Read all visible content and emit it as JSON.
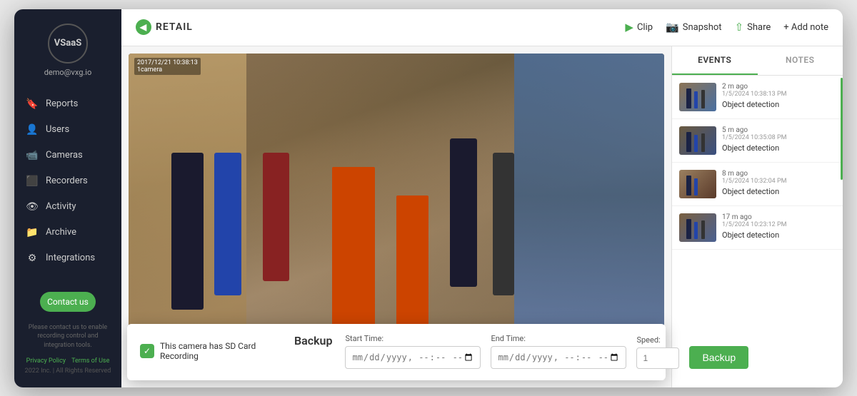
{
  "sidebar": {
    "logo_text": "VSaaS",
    "user_email": "demo@vxg.io",
    "nav_items": [
      {
        "id": "reports",
        "label": "Reports",
        "icon": "🔖"
      },
      {
        "id": "users",
        "label": "Users",
        "icon": "👤"
      },
      {
        "id": "cameras",
        "label": "Cameras",
        "icon": "📹"
      },
      {
        "id": "recorders",
        "label": "Recorders",
        "icon": "⬛"
      },
      {
        "id": "activity",
        "label": "Activity",
        "icon": "👁"
      },
      {
        "id": "archive",
        "label": "Archive",
        "icon": "📁"
      },
      {
        "id": "integrations",
        "label": "Integrations",
        "icon": "⚙"
      }
    ],
    "contact_btn": "Contact us",
    "footer_text": "Please contact us to enable recording control and integration tools.",
    "privacy_link": "Privacy Policy",
    "terms_link": "Terms of Use",
    "copyright": "2022 Inc. | All Rights Reserved"
  },
  "topbar": {
    "back_label": "RETAIL",
    "clip_label": "Clip",
    "snapshot_label": "Snapshot",
    "share_label": "Share",
    "add_note_label": "+ Add note"
  },
  "video": {
    "timestamp": "2017/12/21 10:38:13",
    "camera_label": "1camera"
  },
  "backup_main": {
    "sd_notice": "This camera has SD Card Recording",
    "title": "Backup",
    "start_time_label": "Start Time:",
    "start_time_placeholder": "yyyy-mm-dd --:-- --",
    "end_time_label": "End Time:",
    "end_time_placeholder": "yyyy-mm-dd --:-- --",
    "speed_label": "Speed:",
    "speed_value": "1",
    "backup_btn": "Backup"
  },
  "backup_secondary": {
    "sd_notice": "This camera has SD Card Recording",
    "title": "Backup",
    "start_time_label": "Start Time:",
    "start_time_placeholder": "yyyy-mm-dd --:-- --",
    "end_time_label": "End Time:",
    "end_time_placeholder": "yyyy-mm-dd --:-- --",
    "speed_label": "Speed:",
    "speed_value": "1",
    "backup_btn": "Backup"
  },
  "events_panel": {
    "tab_events": "EVENTS",
    "tab_notes": "NOTES",
    "events": [
      {
        "time_ago": "2 m ago",
        "timestamp": "1/5/2024 10:38:13 PM",
        "type": "Object detection"
      },
      {
        "time_ago": "5 m ago",
        "timestamp": "1/5/2024 10:35:08 PM",
        "type": "Object detection"
      },
      {
        "time_ago": "8 m ago",
        "timestamp": "1/5/2024 10:32:04 PM",
        "type": "Object detection"
      },
      {
        "time_ago": "17 m ago",
        "timestamp": "1/5/2024 10:23:12 PM",
        "type": "Object detection"
      }
    ]
  },
  "colors": {
    "green": "#4caf50",
    "dark_sidebar": "#1a1f2e",
    "text_dark": "#333333",
    "text_muted": "#999999"
  }
}
